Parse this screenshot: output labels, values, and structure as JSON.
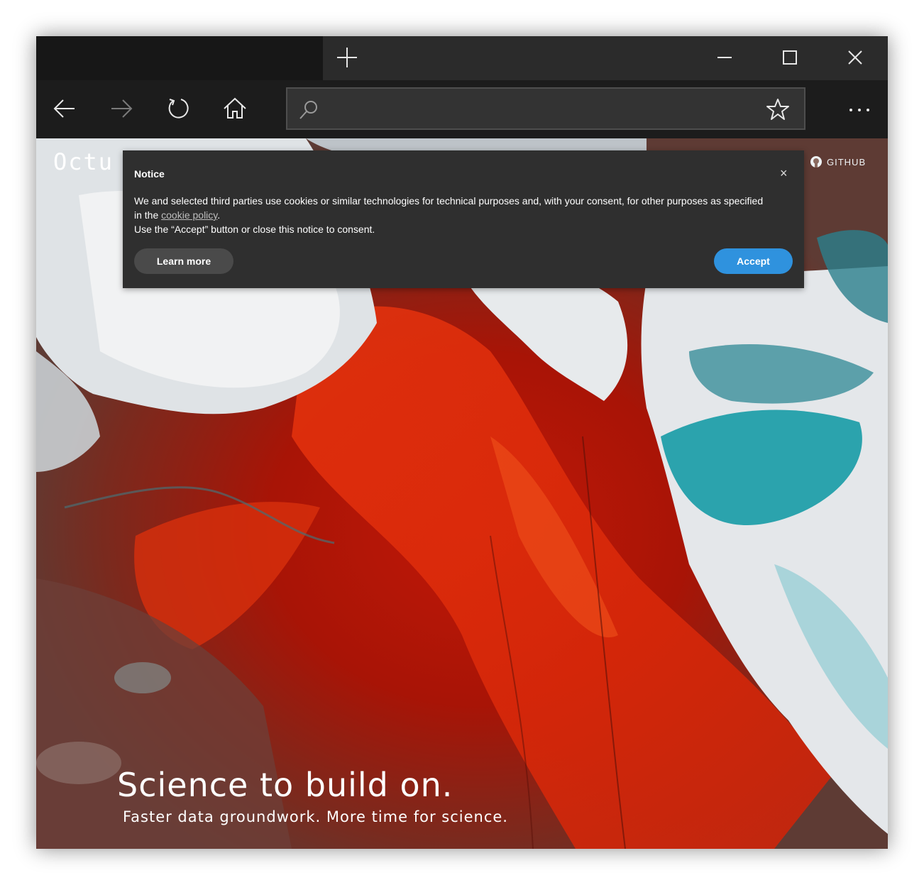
{
  "browser": {
    "new_tab_icon": "plus-icon",
    "window_controls": [
      "minimize-icon",
      "maximize-icon",
      "close-icon"
    ],
    "nav": [
      "back-arrow-icon",
      "forward-arrow-icon",
      "refresh-icon",
      "home-icon"
    ],
    "address": {
      "value": "",
      "placeholder": ""
    },
    "more_label": "···"
  },
  "site": {
    "logo_text": "Octu",
    "github_label": "GITHUB",
    "hero_title": "Science to build on.",
    "hero_subtitle": "Faster data groundwork. More time for science."
  },
  "notice": {
    "title": "Notice",
    "close_label": "×",
    "body_line1": "We and selected third parties use cookies or similar technologies for technical purposes and, with your consent, for other purposes as specified",
    "body_line2_prefix": "in the ",
    "cookie_link": "cookie policy",
    "body_line2_suffix": ".",
    "body_line3": "Use the “Accept” button or close this notice to consent.",
    "learn_more": "Learn more",
    "accept": "Accept"
  },
  "colors": {
    "accept_button": "#2f92de",
    "notice_bg": "#2f2f2f",
    "titlebar": "#171717",
    "toolbar": "#1c1c1c"
  }
}
